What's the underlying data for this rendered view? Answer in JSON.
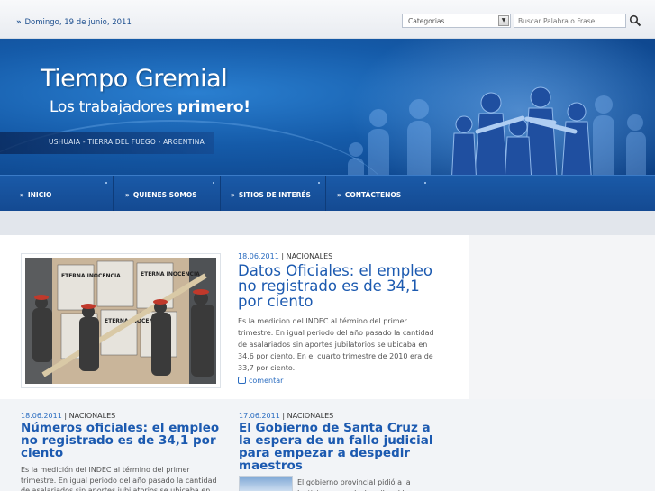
{
  "topbar": {
    "date": "Domingo, 19 de junio, 2011",
    "category_select": "Categorias",
    "search_placeholder": "Buscar Palabra o Frase"
  },
  "banner": {
    "title_part1": "Tiempo",
    "title_part2": "Gremial",
    "subtitle_regular": "Los trabajadores",
    "subtitle_bold": "primero!",
    "location": "USHUAIA - TIERRA DEL FUEGO - ARGENTINA"
  },
  "nav": {
    "items": [
      "INICIO",
      "QUIENES SOMOS",
      "SITIOS DE INTERÉS",
      "CONTÁCTENOS"
    ]
  },
  "featured": {
    "date": "18.06.2011",
    "category": "NACIONALES",
    "title": "Datos Oficiales: el empleo no registrado es de 34,1 por ciento",
    "body": "Es la medicion del INDEC al término del primer trimestre. En igual periodo del año pasado la cantidad de asalariados sin aportes jubilatorios se ubicaba en 34,6 por ciento. En el cuarto trimestre de 2010 era de 33,7 por ciento.",
    "comment_label": "comentar",
    "poster_text": "ETERNA INOCENCIA"
  },
  "cards": [
    {
      "date": "18.06.2011",
      "category": "NACIONALES",
      "title": "Números oficiales: el empleo no registrado es de 34,1 por ciento",
      "body": "Es la medición del INDEC al término del primer trimestre. En igual periodo del año pasado la cantidad de asalariados sin aportes jubilatorios se ubicaba en"
    },
    {
      "date": "17.06.2011",
      "category": "NACIONALES",
      "title": "El Gobierno de Santa Cruz a la espera de un fallo judicial para empezar a despedir maestros",
      "body": "El gobierno provincial pidió a la Justicia que se declare ilegal la"
    }
  ],
  "colors": {
    "brand_blue": "#1c5ab0",
    "nav_blue": "#1a5aa8",
    "link_blue": "#2a6cc0"
  }
}
